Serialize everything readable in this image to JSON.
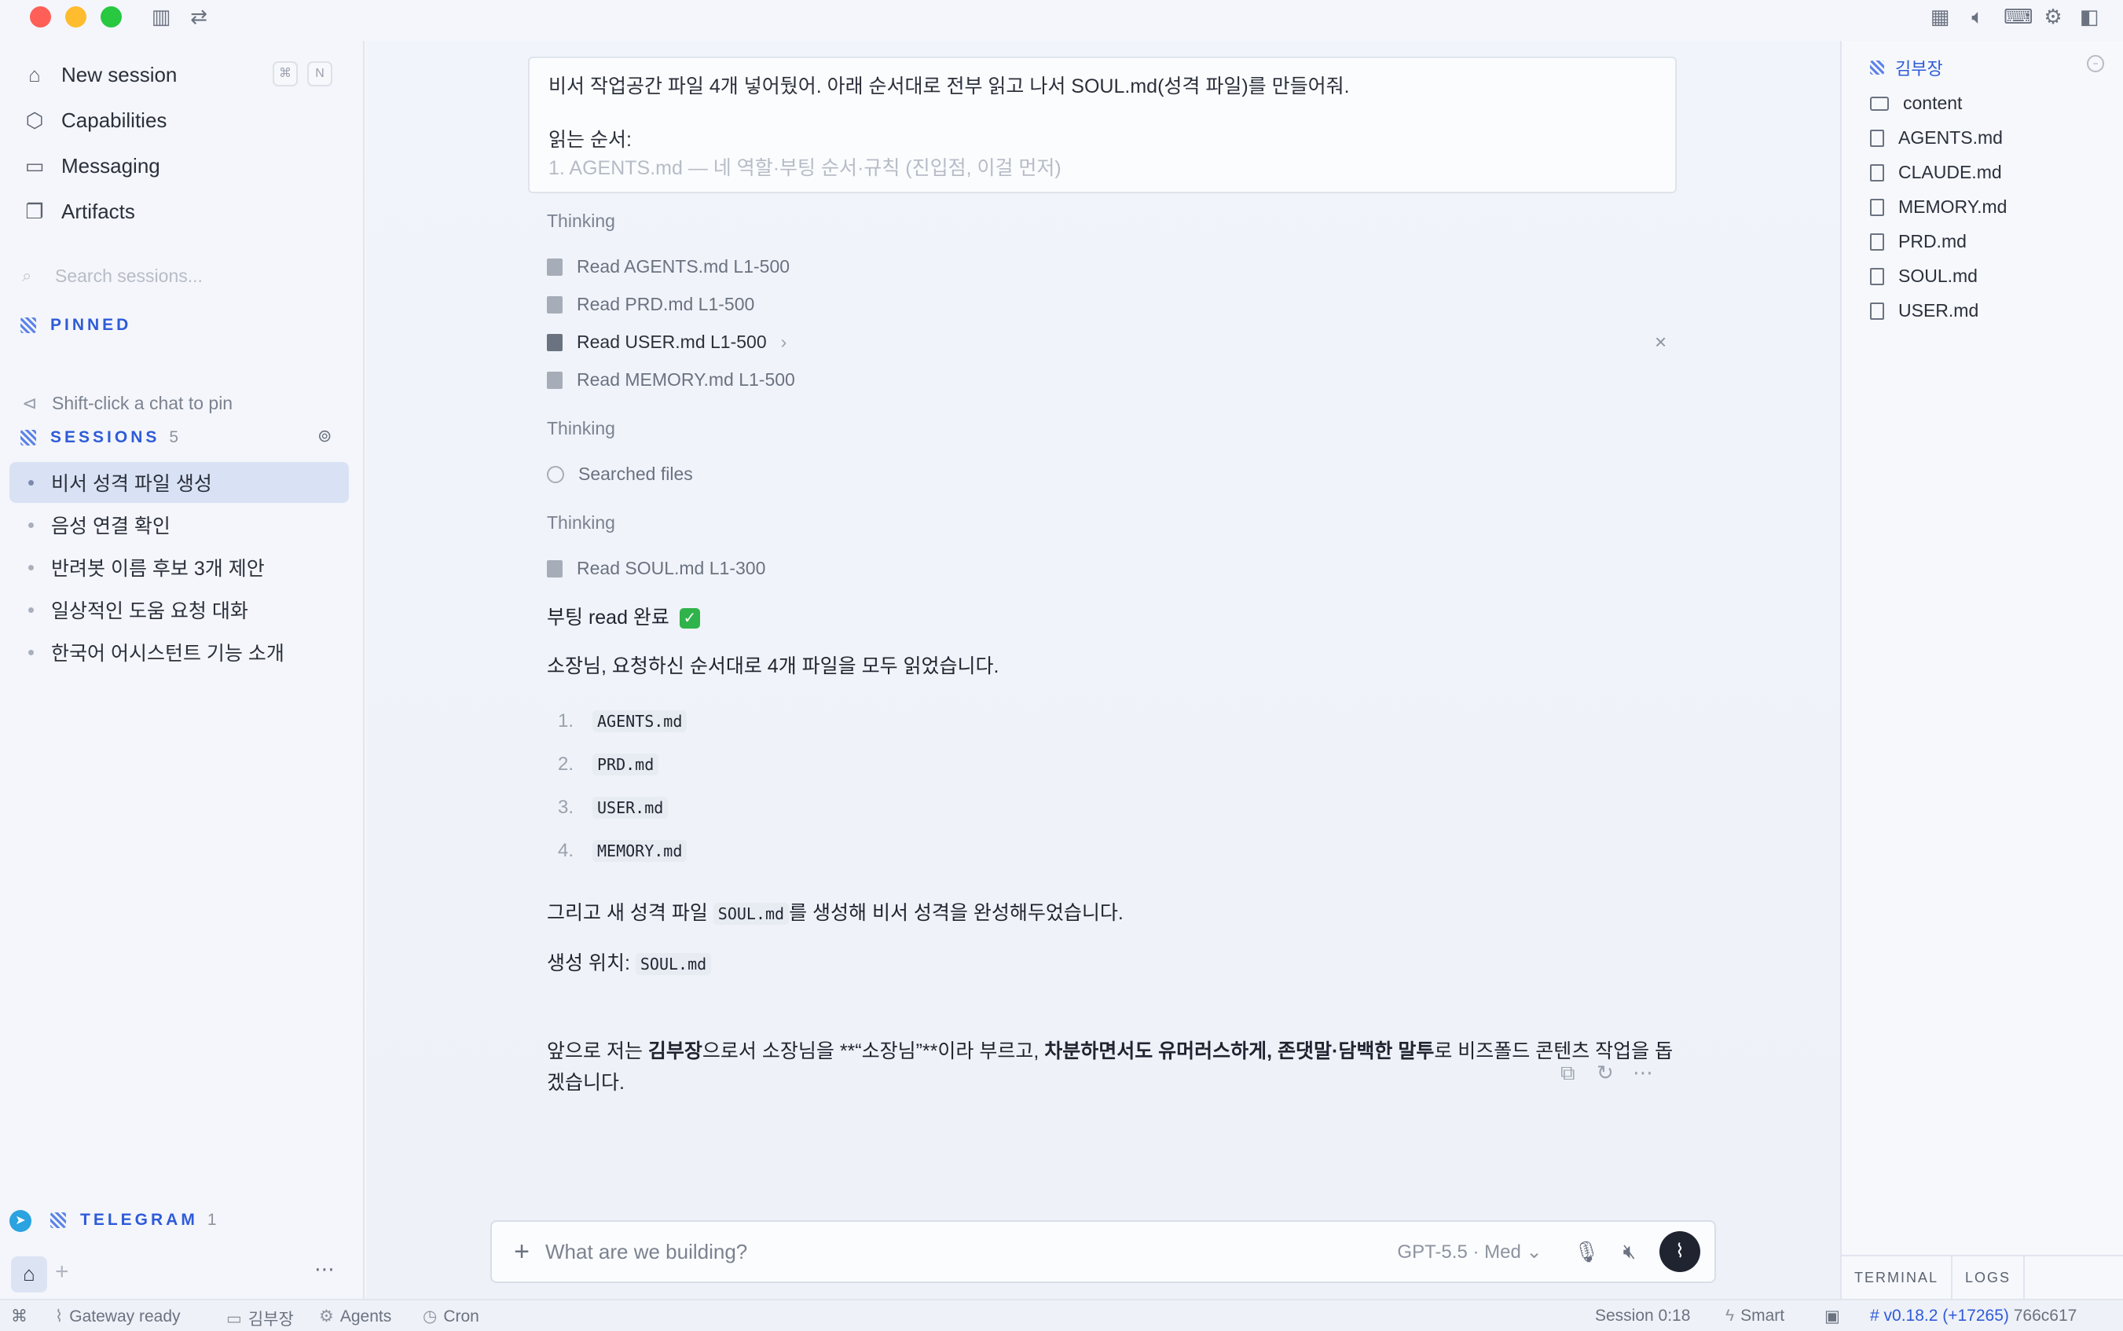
{
  "titlebar": {
    "colors": {
      "close": "#ff5f57",
      "minimize": "#febc2e",
      "maximize": "#28c840"
    }
  },
  "sidebar": {
    "nav": [
      {
        "label": "New session",
        "icon": "broom-icon"
      },
      {
        "label": "Capabilities",
        "icon": "shapes-icon"
      },
      {
        "label": "Messaging",
        "icon": "chat-bubble-icon"
      },
      {
        "label": "Artifacts",
        "icon": "documents-icon"
      }
    ],
    "shortcut_keys": [
      "⌘",
      "N"
    ],
    "search_placeholder": "Search sessions...",
    "pinned": {
      "title": "PINNED",
      "hint": "Shift-click a chat to pin"
    },
    "sessions": {
      "title": "SESSIONS",
      "count": "5",
      "items": [
        "비서 성격 파일 생성",
        "음성 연결 확인",
        "반려봇 이름 후보 3개 제안",
        "일상적인 도움 요청 대화",
        "한국어 어시스턴트 기능 소개"
      ]
    },
    "telegram": {
      "title": "TELEGRAM",
      "count": "1"
    }
  },
  "main": {
    "prompt_line1": "비서 작업공간 파일 4개 넣어뒀어. 아래 순서대로 전부 읽고 나서 SOUL.md(성격 파일)를 만들어줘.",
    "prompt_line2": "읽는 순서:",
    "prompt_line3": "1. AGENTS.md — 네 역할·부팅 순서·규칙 (진입점, 이걸 먼저)",
    "thinking_label": "Thinking",
    "steps_group1": [
      "Read AGENTS.md L1-500",
      "Read PRD.md L1-500",
      "Read USER.md L1-500",
      "Read MEMORY.md L1-500"
    ],
    "searched": "Searched files",
    "read_soul": "Read SOUL.md L1-300",
    "boot_done": "부팅 read 완료",
    "check_emoji": "✓",
    "summary": "소장님, 요청하신 순서대로 4개 파일을 모두 읽었습니다.",
    "files_read": [
      "AGENTS.md",
      "PRD.md",
      "USER.md",
      "MEMORY.md"
    ],
    "created_pre": "그리고 새 성격 파일",
    "created_code": "SOUL.md",
    "created_post": "를 생성해 비서 성격을 완성해두었습니다.",
    "location_label": "생성 위치:",
    "location_code": "SOUL.md",
    "closing_1": "앞으로 저는 ",
    "closing_bold1": "김부장",
    "closing_2": "으로서 소장님을 **“소장님”**이라 부르고, ",
    "closing_bold2": "차분하면서도 유머러스하게, 존댓말·담백한 말투",
    "closing_3": "로 비즈폴드 콘텐츠 작업을 돕",
    "closing_4": "겠습니다."
  },
  "composer": {
    "placeholder": "What are we building?",
    "model": "GPT-5.5 · Med"
  },
  "rightbar": {
    "workspace": "김부장",
    "folder": "content",
    "files": [
      "AGENTS.md",
      "CLAUDE.md",
      "MEMORY.md",
      "PRD.md",
      "SOUL.md",
      "USER.md"
    ],
    "tabs": [
      "TERMINAL",
      "LOGS"
    ]
  },
  "statusbar": {
    "gateway": "Gateway ready",
    "workspace": "김부장",
    "agents": "Agents",
    "cron": "Cron",
    "session": "Session 0:18",
    "mode": "Smart",
    "version": "v0.18.2 (+17265)",
    "hash": "766c617"
  }
}
